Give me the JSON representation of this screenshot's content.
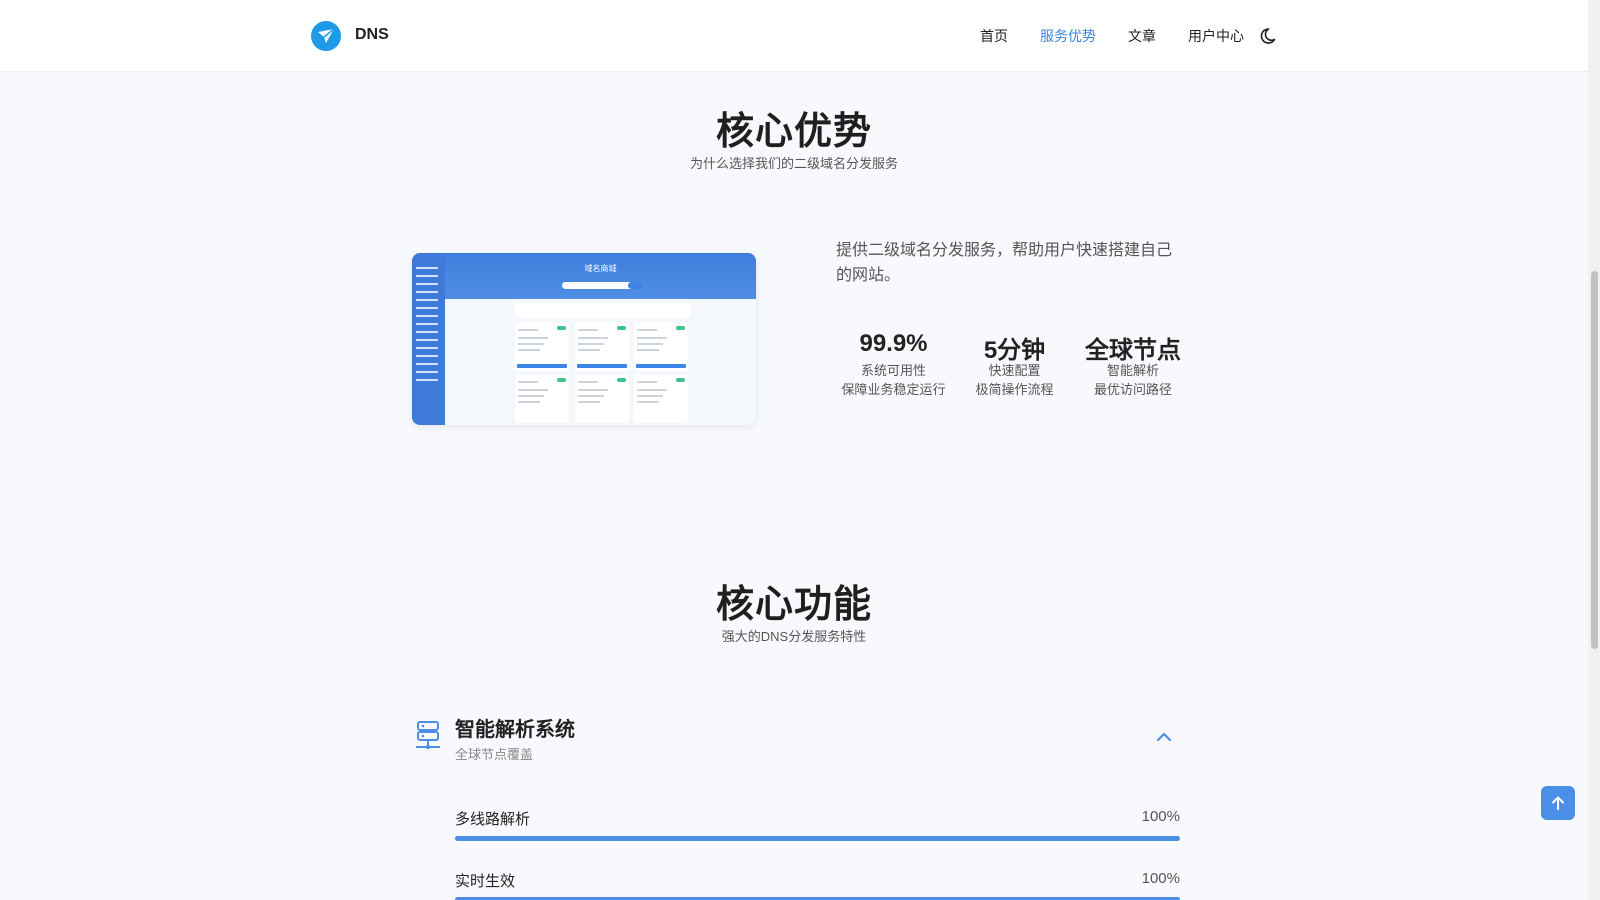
{
  "header": {
    "brand": "DNS",
    "nav": [
      "首页",
      "服务优势",
      "文章",
      "用户中心"
    ],
    "active_nav": "服务优势",
    "accent": "#3b86e6"
  },
  "advantages": {
    "title": "核心优势",
    "subtitle": "为什么选择我们的二级域名分发服务",
    "shot_title": "域名商城",
    "intro": "提供二级域名分发服务，帮助用户快速搭建自己的网站。",
    "stats": [
      {
        "value": "99.9%",
        "label1": "系统可用性",
        "label2": "保障业务稳定运行"
      },
      {
        "value": "5分钟",
        "label1": "快速配置",
        "label2": "极简操作流程"
      },
      {
        "value": "全球节点",
        "label1": "智能解析",
        "label2": "最优访问路径"
      }
    ]
  },
  "features": {
    "title": "核心功能",
    "subtitle": "强大的DNS分发服务特性",
    "item": {
      "title": "智能解析系统",
      "subtitle": "全球节点覆盖",
      "bars": [
        {
          "label": "多线路解析",
          "value": "100%",
          "fraction": 1.0
        },
        {
          "label": "实时生效",
          "value": "100%",
          "fraction": 1.0
        }
      ]
    }
  },
  "icons": {
    "logo": "paper-plane-logo",
    "theme_toggle": "moon-icon",
    "feature": "server-network-icon",
    "collapse": "chevron-up-icon",
    "back_to_top": "arrow-up-icon"
  }
}
